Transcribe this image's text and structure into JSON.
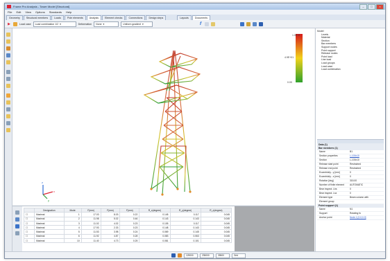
{
  "window": {
    "title": "Frame Pro Analysis - Tower Model [Structural]"
  },
  "menu": [
    "File",
    "Edit",
    "View",
    "Options",
    "Standards",
    "Help"
  ],
  "tabs": [
    "Geometry",
    "Structural members",
    "Loads",
    "Pole elements",
    "Analysis",
    "Element checks",
    "Connections",
    "Design steps",
    "Layouts",
    "Documents"
  ],
  "active_tab": "Analysis",
  "toolbar": {
    "load_case_label": "Load case",
    "load_case_value": "Load combination 1/2",
    "deformation_label": "Deformation",
    "deformation_value": "None",
    "display_value": "Uniform gradient"
  },
  "colorbar": {
    "max_label": "1.0E+2",
    "mid_label": "4.9E+01",
    "min_label": "0.00"
  },
  "tree": {
    "root": "Model",
    "items": [
      "Levels",
      "Material",
      "Section",
      "Bar members",
      "Support nodes",
      "Point support",
      "Release nodes",
      "Point load",
      "Line load",
      "Load groups",
      "Load case",
      "Load combination"
    ]
  },
  "properties": {
    "sections": [
      {
        "title": "Data (1)",
        "rows": []
      },
      {
        "title": "Bar members (1)",
        "rows": [
          {
            "k": "Name",
            "v": "B1"
          },
          {
            "k": "Section properties",
            "v": "L-100x10",
            "link": true
          },
          {
            "k": "Section",
            "v": "L-100x10"
          },
          {
            "k": "Release start point",
            "v": "Restrained"
          },
          {
            "k": "Release end point",
            "v": "Restrained"
          },
          {
            "k": "Eccentricity - y [mm]",
            "v": "0"
          },
          {
            "k": "Eccentricity - z [mm]",
            "v": "0"
          },
          {
            "k": "Rotation [deg]",
            "v": "315.00"
          },
          {
            "k": "Number of finite element",
            "v": "AUTOMATIC"
          },
          {
            "k": "Bear inspect. Lbs",
            "v": "0"
          },
          {
            "k": "Bear inspect. Lsz",
            "v": "0"
          },
          {
            "k": "Element type",
            "v": "Beam column with"
          },
          {
            "k": "Element group",
            "v": ""
          }
        ]
      },
      {
        "title": "Point support (1)",
        "rows": [
          {
            "k": "Name",
            "v": "N1"
          },
          {
            "k": "Support",
            "v": "Rotating fo"
          },
          {
            "k": "Anchor point",
            "v": "Node 1 [0.0;0.0]",
            "link": true
          }
        ]
      }
    ]
  },
  "table": {
    "headers": [
      "",
      "Designation",
      "Mode",
      "F(mm)",
      "F(mm)",
      "F(mm)",
      "R_x(degree)",
      "R_y(degree)",
      "R_z(degree)"
    ],
    "rows": [
      [
        "",
        "Maximal",
        "1",
        "17.03",
        "8.03",
        "0.22",
        "0.145",
        "0.117",
        "0.045"
      ],
      [
        "",
        "Maximal",
        "2",
        "11.98",
        "5.02",
        "0.46",
        "0.143",
        "0.143",
        "0.045"
      ],
      [
        "",
        "Maximal",
        "3",
        "11.02",
        "4.02",
        "0.23",
        "0.105",
        "0.117",
        "0.045"
      ],
      [
        "",
        "Maximal",
        "4",
        "17.93",
        "2.33",
        "0.23",
        "0.148",
        "0.143",
        "0.045"
      ],
      [
        "",
        "Maximal",
        "5",
        "11.53",
        "3.98",
        "0.24",
        "0.069",
        "0.145",
        "0.045"
      ],
      [
        "",
        "Maximal",
        "6",
        "11.92",
        "4.87",
        "0.28",
        "0.083",
        "0.063",
        "0.045"
      ],
      [
        "",
        "Maximal",
        "10",
        "11.40",
        "4.73",
        "0.25",
        "0.081",
        "0.101",
        "0.045"
      ]
    ]
  },
  "status": {
    "fields": [
      "129000",
      "235000",
      "39500",
      "Grid"
    ]
  },
  "axes": {
    "x": "x",
    "y": "y",
    "z": "z"
  },
  "colors": {
    "accent": "#d61a1a",
    "member_high": "#c0392b",
    "member_mid": "#d5c52a",
    "member_low": "#2e9e3a"
  }
}
